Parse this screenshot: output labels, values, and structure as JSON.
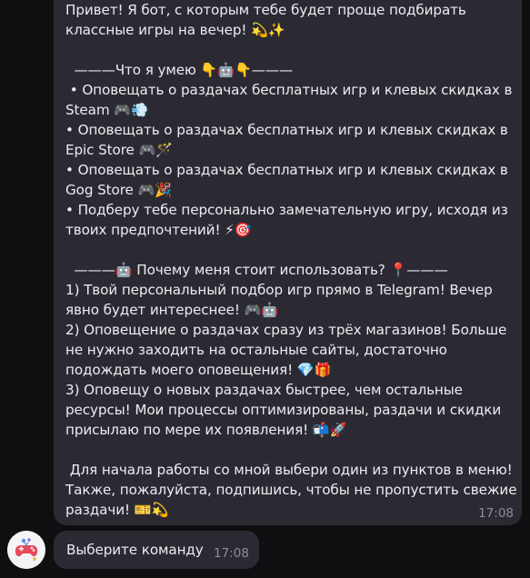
{
  "message": {
    "lines": [
      "Привет! Я бот, с которым тебе будет проще подбирать",
      "классные игры на вечер! 💫✨",
      "",
      "  ———Что я умею 👇🤖👇———",
      " • Оповещать о раздачах бесплатных игр и клевых скидках в",
      "Steam 🎮💨",
      "• Оповещать о раздачах бесплатных игр и клевых скидках в",
      "Epic Store 🎮🪄",
      "• Оповещать о раздачах бесплатных игр и клевых скидках в",
      "Gog Store 🎮🎉",
      "• Подберу тебе персонально замечательную игру, исходя из",
      "твоих предпочтений! ⚡🎯",
      "",
      "  ———🤖 Почему меня стоит использовать? 📍———",
      "1) Твой персональный подбор игр прямо в Telegram! Вечер",
      "явно будет интереснее! 🎮🤖",
      "2) Оповещение о раздачах сразу из трёх магазинов! Больше",
      "не нужно заходить на остальные сайты, достаточно",
      "подождать моего оповещения! 💎🎁",
      "3) Оповещу о новых раздачах быстрее, чем остальные",
      "ресурсы! Мои процессы оптимизированы, раздачи и скидки",
      "присылаю по мере их появления! 📬🚀",
      "",
      " Для начала работы со мной выбери один из пунктов в меню!",
      "Также, пожалуйста, подпишись, чтобы не пропустить свежие",
      "раздачи! 🎫💫"
    ],
    "time": "17:08"
  },
  "reply": {
    "text": "Выберите команду",
    "time": "17:08"
  },
  "avatar": {
    "icon": "gamepad-robot-avatar-icon"
  },
  "colors": {
    "background": "#0f0f12",
    "bubble": "#2b2a33",
    "text": "#ececf0",
    "time": "#8e8c99"
  }
}
